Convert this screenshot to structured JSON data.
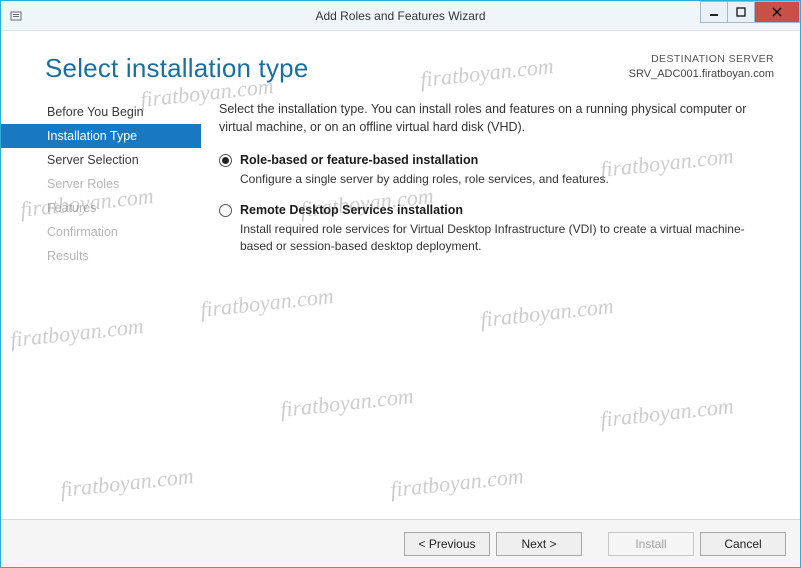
{
  "window": {
    "title": "Add Roles and Features Wizard"
  },
  "header": {
    "page_title": "Select installation type",
    "destination_label": "DESTINATION SERVER",
    "destination_value": "SRV_ADC001.firatboyan.com"
  },
  "sidebar": {
    "items": [
      {
        "label": "Before You Begin",
        "state": "enabled"
      },
      {
        "label": "Installation Type",
        "state": "active"
      },
      {
        "label": "Server Selection",
        "state": "enabled"
      },
      {
        "label": "Server Roles",
        "state": "disabled"
      },
      {
        "label": "Features",
        "state": "disabled"
      },
      {
        "label": "Confirmation",
        "state": "disabled"
      },
      {
        "label": "Results",
        "state": "disabled"
      }
    ]
  },
  "content": {
    "intro": "Select the installation type. You can install roles and features on a running physical computer or virtual machine, or on an offline virtual hard disk (VHD).",
    "options": [
      {
        "title": "Role-based or feature-based installation",
        "desc": "Configure a single server by adding roles, role services, and features.",
        "selected": true
      },
      {
        "title": "Remote Desktop Services installation",
        "desc": "Install required role services for Virtual Desktop Infrastructure (VDI) to create a virtual machine-based or session-based desktop deployment.",
        "selected": false
      }
    ]
  },
  "footer": {
    "previous": "< Previous",
    "next": "Next >",
    "install": "Install",
    "cancel": "Cancel"
  },
  "watermark": "firatboyan.com"
}
